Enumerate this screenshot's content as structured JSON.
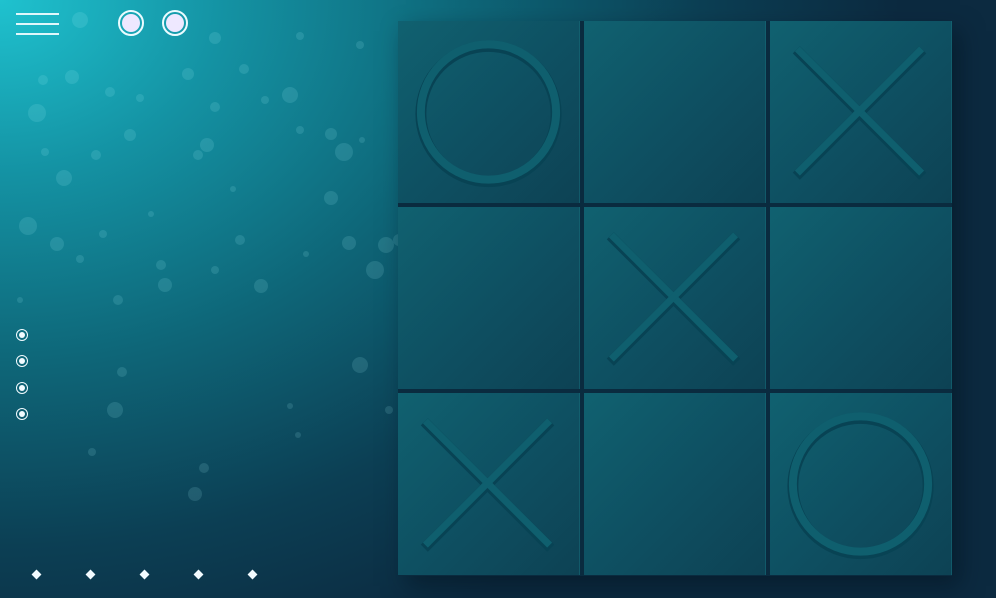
{
  "board": {
    "cells": [
      {
        "mark": "O"
      },
      {
        "mark": ""
      },
      {
        "mark": "X"
      },
      {
        "mark": ""
      },
      {
        "mark": "X"
      },
      {
        "mark": ""
      },
      {
        "mark": "X"
      },
      {
        "mark": ""
      },
      {
        "mark": "O"
      }
    ]
  },
  "players": [
    {
      "icon": "player-one-indicator"
    },
    {
      "icon": "player-two-indicator"
    }
  ],
  "side_nav": {
    "count": 4,
    "icon": "radio-dot-icon"
  },
  "bottom_nav": {
    "count": 5,
    "icon": "diamond-icon"
  },
  "menu": {
    "icon": "hamburger-menu-icon"
  },
  "colors": {
    "background_light": "#1fc2cf",
    "background_dark": "#0c2a40",
    "cell": "#0e5566",
    "mark_fill": "#0f5f6e",
    "mark_edge": "#084354",
    "ui_white": "#f2fbff"
  }
}
